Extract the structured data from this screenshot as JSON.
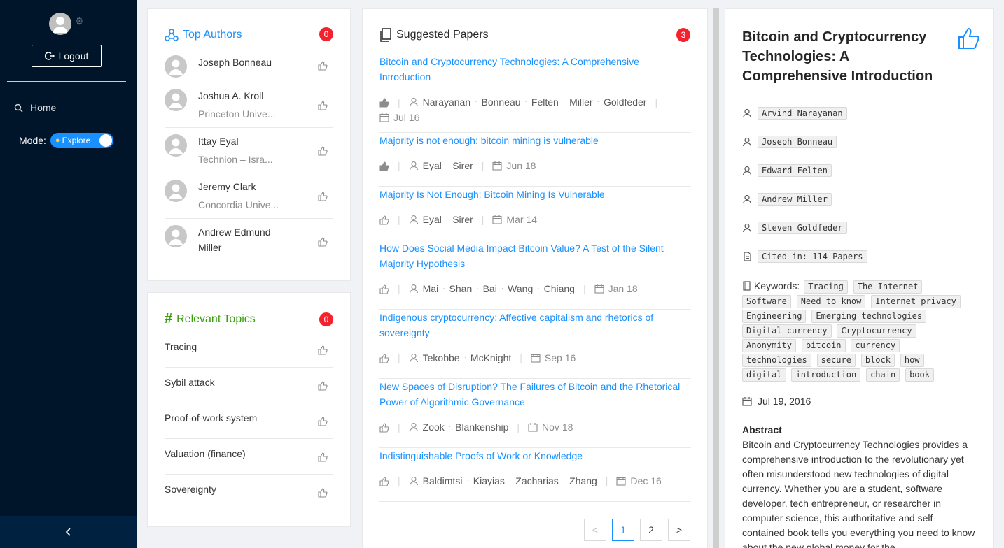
{
  "sidebar": {
    "logout_label": "Logout",
    "home_label": "Home",
    "mode_label": "Mode:",
    "mode_value": "Explore",
    "collapse_icon": "chevron-left-icon"
  },
  "top_authors": {
    "title": "Top Authors",
    "count": "0",
    "items": [
      {
        "name": "Joseph Bonneau",
        "affiliation": ""
      },
      {
        "name": "Joshua A. Kroll",
        "affiliation": "Princeton Unive..."
      },
      {
        "name": "Ittay Eyal",
        "affiliation": "Technion – Isra..."
      },
      {
        "name": "Jeremy Clark",
        "affiliation": "Concordia Unive..."
      },
      {
        "name": "Andrew Edmund Miller",
        "affiliation": ""
      }
    ]
  },
  "relevant_topics": {
    "title": "Relevant Topics",
    "count": "0",
    "items": [
      "Tracing",
      "Sybil attack",
      "Proof-of-work system",
      "Valuation (finance)",
      "Sovereignty"
    ]
  },
  "suggested_papers": {
    "title": "Suggested Papers",
    "count": "3",
    "items": [
      {
        "title": "Bitcoin and Cryptocurrency Technologies: A Comprehensive Introduction",
        "liked": true,
        "authors": [
          "Narayanan",
          "Bonneau",
          "Felten",
          "Miller",
          "Goldfeder"
        ],
        "date": "Jul 16"
      },
      {
        "title": "Majority is not enough: bitcoin mining is vulnerable",
        "liked": true,
        "authors": [
          "Eyal",
          "Sirer"
        ],
        "date": "Jun 18"
      },
      {
        "title": "Majority Is Not Enough: Bitcoin Mining Is Vulnerable",
        "liked": false,
        "authors": [
          "Eyal",
          "Sirer"
        ],
        "date": "Mar 14"
      },
      {
        "title": "How Does Social Media Impact Bitcoin Value? A Test of the Silent Majority Hypothesis",
        "liked": false,
        "authors": [
          "Mai",
          "Shan",
          "Bai",
          "Wang",
          "Chiang"
        ],
        "date": "Jan 18"
      },
      {
        "title": "Indigenous cryptocurrency: Affective capitalism and rhetorics of sovereignty",
        "liked": false,
        "authors": [
          "Tekobbe",
          "McKnight"
        ],
        "date": "Sep 16"
      },
      {
        "title": "New Spaces of Disruption? The Failures of Bitcoin and the Rhetorical Power of Algorithmic Governance",
        "liked": false,
        "authors": [
          "Zook",
          "Blankenship"
        ],
        "date": "Nov 18"
      },
      {
        "title": "Indistinguishable Proofs of Work or Knowledge",
        "liked": false,
        "authors": [
          "Baldimtsi",
          "Kiayias",
          "Zacharias",
          "Zhang"
        ],
        "date": "Dec 16"
      }
    ],
    "pagination": {
      "prev": "<",
      "pages": [
        "1",
        "2"
      ],
      "current": "1",
      "next": ">"
    }
  },
  "detail": {
    "title": "Bitcoin and Cryptocurrency Technologies: A Comprehensive Introduction",
    "authors": [
      "Arvind Narayanan",
      "Joseph Bonneau",
      "Edward Felten",
      "Andrew Miller",
      "Steven Goldfeder"
    ],
    "cited": "Cited in: 114 Papers",
    "keywords_label": "Keywords:",
    "keywords": [
      "Tracing",
      "The Internet",
      "Software",
      "Need to know",
      "Internet privacy",
      "Engineering",
      "Emerging technologies",
      "Digital currency",
      "Cryptocurrency",
      "Anonymity",
      "bitcoin",
      "currency",
      "technologies",
      "secure",
      "block",
      "how",
      "digital",
      "introduction",
      "chain",
      "book"
    ],
    "date": "Jul 19, 2016",
    "abstract_label": "Abstract",
    "abstract": "Bitcoin and Cryptocurrency Technologies provides a comprehensive introduction to the revolutionary yet often misunderstood new technologies of digital currency. Whether you are a student, software developer, tech entrepreneur, or researcher in computer science, this authoritative and self-contained book tells you everything you need to know about the new global money for the"
  },
  "colors": {
    "sidebar": "#001529",
    "link": "#1890ff",
    "badge": "#f5222d",
    "topics": "#389e0d"
  }
}
